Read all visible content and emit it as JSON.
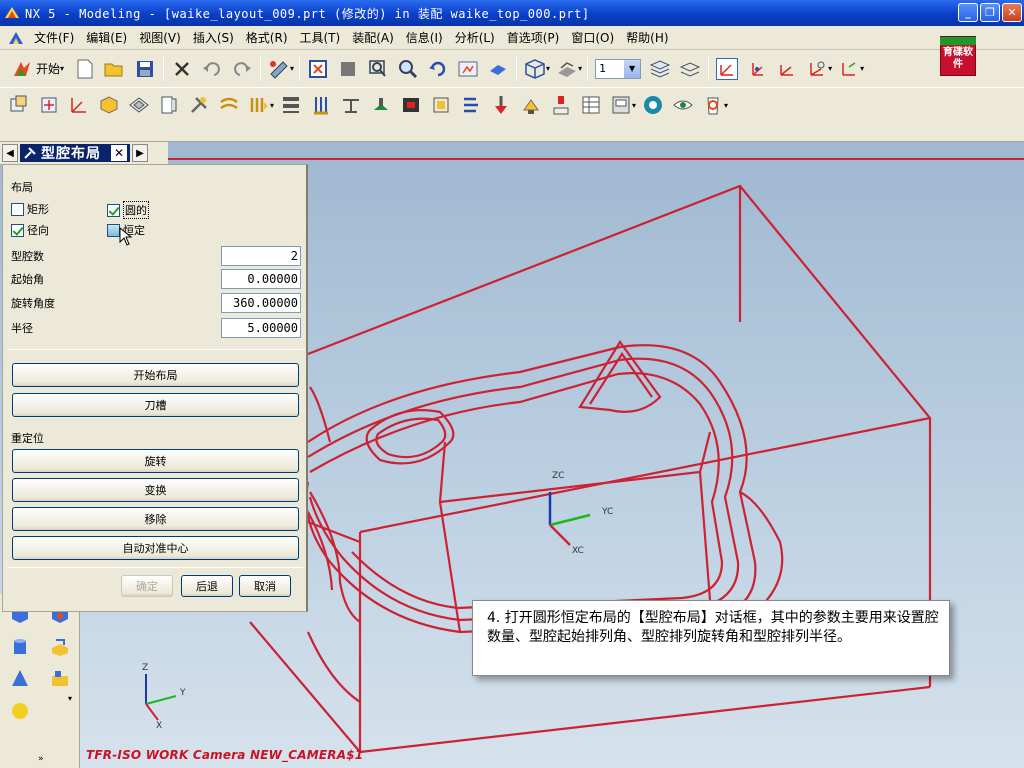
{
  "window": {
    "title": "NX 5 - Modeling - [waike_layout_009.prt  (修改的)   in 装配 waike_top_000.prt]"
  },
  "menu": {
    "items": [
      "文件(F)",
      "编辑(E)",
      "视图(V)",
      "插入(S)",
      "格式(R)",
      "工具(T)",
      "装配(A)",
      "信息(I)",
      "分析(L)",
      "首选项(P)",
      "窗口(O)",
      "帮助(H)"
    ]
  },
  "logo": {
    "text": "育碟软件"
  },
  "toolbar": {
    "start_label": "开始",
    "layer_value": "1"
  },
  "navigator": {
    "title": "型腔布局"
  },
  "dialog": {
    "layout_section": "布局",
    "rect_label": "矩形",
    "rect_checked": false,
    "circle_label": "圆的",
    "circle_checked": true,
    "radial_label": "径向",
    "radial_checked": true,
    "constant_label": "恒定",
    "constant_checked": false,
    "fields": [
      {
        "label": "型腔数",
        "value": "2"
      },
      {
        "label": "起始角",
        "value": "0.00000"
      },
      {
        "label": "旋转角度",
        "value": "360.00000"
      },
      {
        "label": "半径",
        "value": "5.00000"
      }
    ],
    "start_layout_btn": "开始布局",
    "tool_slot_btn": "刀槽",
    "reposition_section": "重定位",
    "rotate_btn": "旋转",
    "transform_btn": "变换",
    "remove_btn": "移除",
    "auto_center_btn": "自动对准中心",
    "ok_btn": "确定",
    "back_btn": "后退",
    "cancel_btn": "取消"
  },
  "viewport": {
    "camera_label": "TFR-ISO WORK Camera NEW_CAMERA$1",
    "axes": {
      "z": "ZC",
      "y": "YC",
      "x": "XC"
    },
    "triad": {
      "z": "Z",
      "y": "Y",
      "x": "X"
    }
  },
  "caption": {
    "text": "4. 打开圆形恒定布局的【型腔布局】对话框，其中的参数主要用来设置腔数量、型腔起始排列角、型腔排列旋转角和型腔排列半径。"
  },
  "colors": {
    "wireframe": "#cc2233",
    "titlebar": "#0a3fc8",
    "viewport_top": "#9fb8d0",
    "viewport_bottom": "#d6e2ec"
  }
}
